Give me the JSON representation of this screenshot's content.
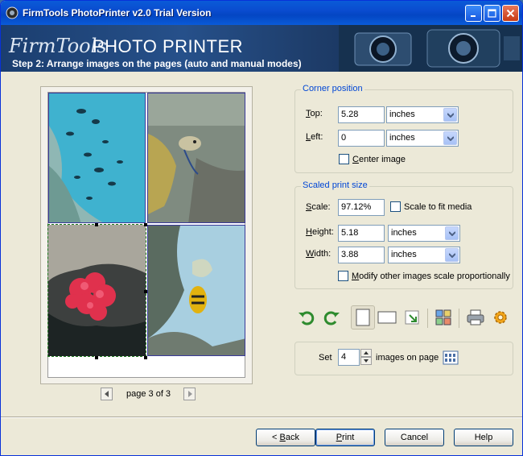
{
  "window": {
    "title": "FirmTools PhotoPrinter v2.0 Trial Version",
    "controls": [
      "minimize",
      "maximize",
      "close"
    ]
  },
  "banner": {
    "brand_script": "FirmTools",
    "brand_main": "PHOTO PRINTER",
    "step": "Step 2: Arrange images on the pages (auto and manual modes)"
  },
  "preview": {
    "pager_text": "page 3 of 3"
  },
  "corner_position": {
    "legend": "Corner position",
    "top_label_u": "T",
    "top_label_rest": "op:",
    "top_value": "5.28",
    "top_unit": "inches",
    "left_label_u": "L",
    "left_label_rest": "eft:",
    "left_value": "0",
    "left_unit": "inches",
    "center_label_u": "C",
    "center_label_rest": "enter image"
  },
  "scaled_size": {
    "legend": "Scaled print size",
    "scale_label_u": "S",
    "scale_label_rest": "cale:",
    "scale_value": "97.12%",
    "fit_label": "Scale to fit media",
    "height_label_u": "H",
    "height_label_rest": "eight:",
    "height_value": "5.18",
    "height_unit": "inches",
    "width_label_u": "W",
    "width_label_rest": "idth:",
    "width_value": "3.88",
    "width_unit": "inches",
    "modify_label_u": "M",
    "modify_label_rest": "odify other images scale proportionally"
  },
  "images_per_page": {
    "set_label": "Set",
    "value": "4",
    "suffix": "images on page"
  },
  "buttons": {
    "back_u": "B",
    "back_rest": "ack",
    "back_prefix": "< ",
    "print_u": "P",
    "print_rest": "rint",
    "cancel": "Cancel",
    "help": "Help"
  },
  "colors": {
    "title_bar": "#0a4ccf",
    "group_legend": "#0046d5",
    "selection_outline": "#1f7a1f"
  }
}
